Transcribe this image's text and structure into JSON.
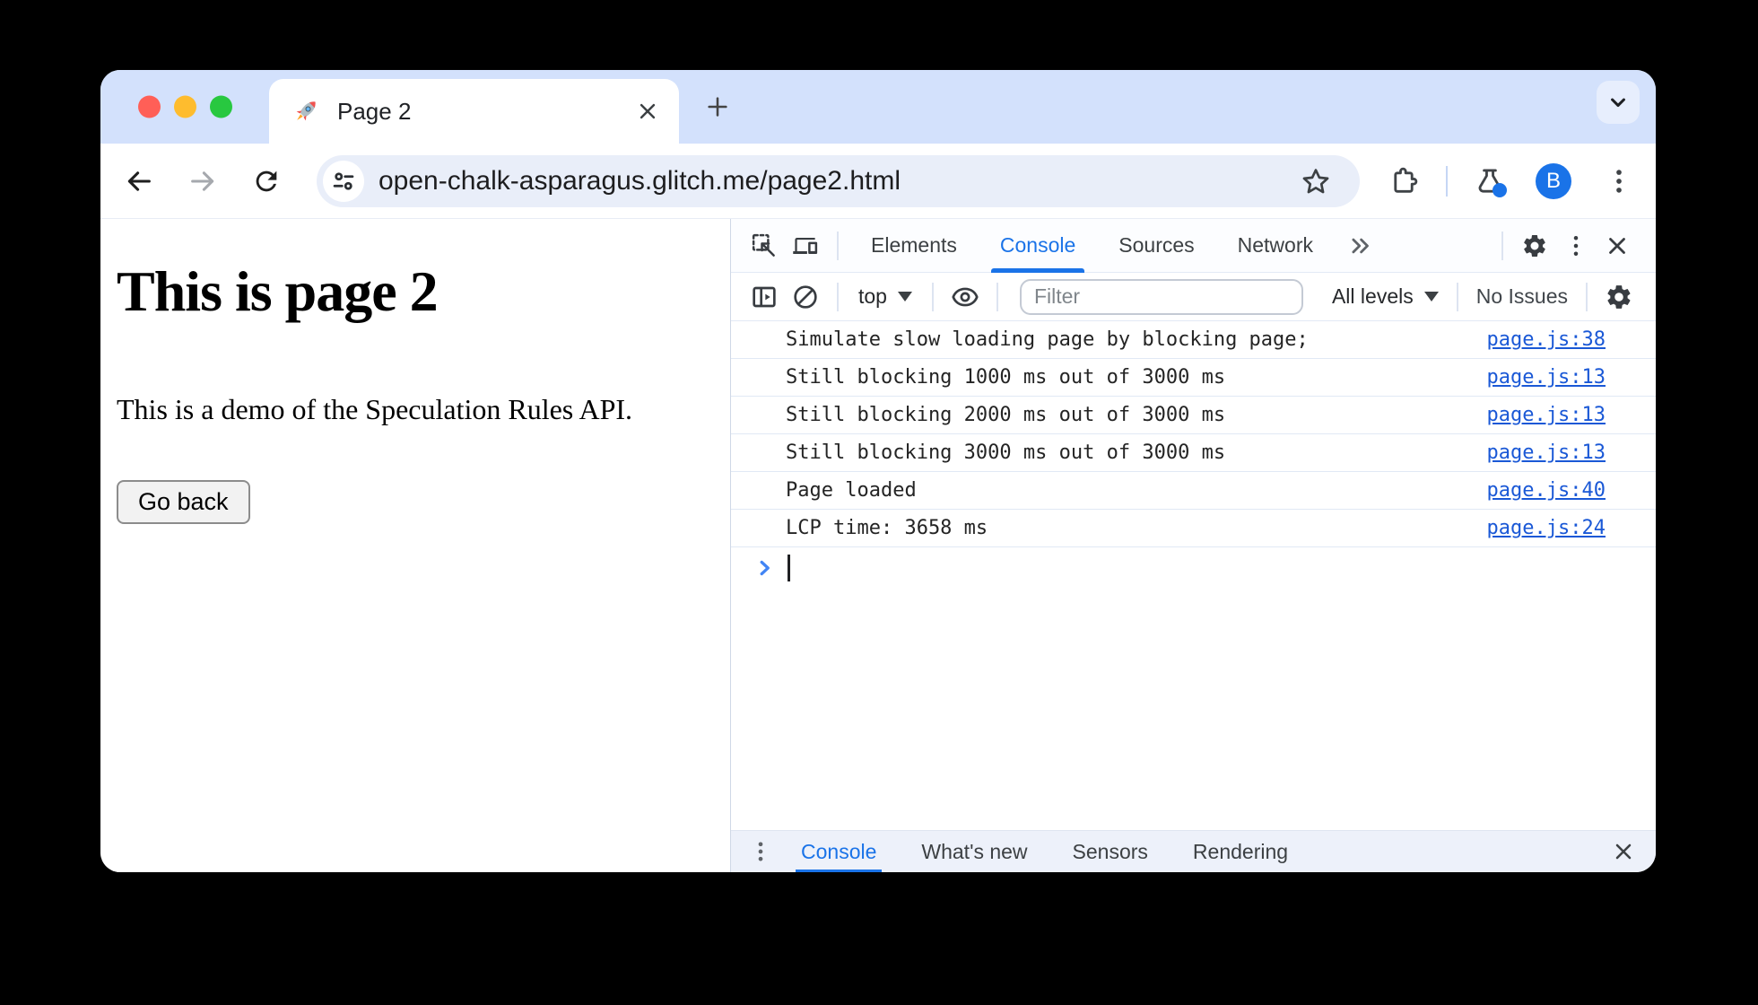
{
  "browser": {
    "tab_title": "Page 2",
    "url": "open-chalk-asparagus.glitch.me/page2.html",
    "new_tab_label": "+",
    "avatar_label": "B"
  },
  "page": {
    "heading": "This is page 2",
    "paragraph": "This is a demo of the Speculation Rules API.",
    "button_label": "Go back"
  },
  "devtools": {
    "tabs": [
      "Elements",
      "Console",
      "Sources",
      "Network"
    ],
    "active_tab": "Console",
    "toolbar": {
      "context": "top",
      "filter_placeholder": "Filter",
      "levels_label": "All levels",
      "issues_label": "No Issues"
    },
    "messages": [
      {
        "text": "Simulate slow loading page by blocking page;",
        "source": "page.js:38"
      },
      {
        "text": "Still blocking 1000 ms out of 3000 ms",
        "source": "page.js:13"
      },
      {
        "text": "Still blocking 2000 ms out of 3000 ms",
        "source": "page.js:13"
      },
      {
        "text": "Still blocking 3000 ms out of 3000 ms",
        "source": "page.js:13"
      },
      {
        "text": "Page loaded",
        "source": "page.js:40"
      },
      {
        "text": "LCP time: 3658 ms",
        "source": "page.js:24"
      }
    ],
    "drawer": {
      "tabs": [
        "Console",
        "What's new",
        "Sensors",
        "Rendering"
      ],
      "active_tab": "Console"
    }
  },
  "colors": {
    "accent_blue": "#1a73e8",
    "link_blue": "#1a58d6",
    "tabstrip": "#d3e1fc",
    "urlbar": "#e9eef9",
    "traffic_red": "#ff5f57",
    "traffic_yellow": "#febc2e",
    "traffic_green": "#28c840"
  }
}
